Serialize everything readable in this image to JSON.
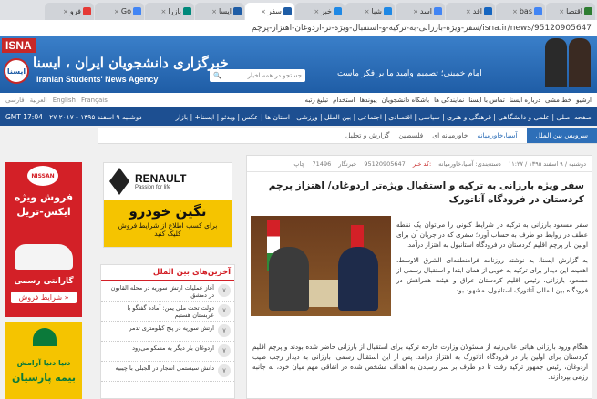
{
  "browser": {
    "tabs": [
      {
        "label": "اقتصا",
        "color": "#2e7d32",
        "active": false
      },
      {
        "label": "bas",
        "color": "#4285f4",
        "active": false
      },
      {
        "label": "اقد",
        "color": "#1565c0",
        "active": false
      },
      {
        "label": "اسد",
        "color": "#4285f4",
        "active": false
      },
      {
        "label": "شبا",
        "color": "#1e88e5",
        "active": false
      },
      {
        "label": "خبر",
        "color": "#1e88e5",
        "active": false
      },
      {
        "label": "سفر",
        "color": "#1f5da6",
        "active": true
      },
      {
        "label": "ایسا",
        "color": "#1f5da6",
        "active": false
      },
      {
        "label": "بازرا",
        "color": "#00897b",
        "active": false
      },
      {
        "label": "Go",
        "color": "#4285f4",
        "active": false
      },
      {
        "label": "فرو",
        "color": "#e53935",
        "active": false
      }
    ],
    "url": "isna.ir/news/95120905647/سفر-ویژه-بارزانی-به-ترکیه-و-استقبال-ویژه-تر-اردوغان-اهتزاز-پرچم"
  },
  "header": {
    "logo": "ISNA",
    "emblem": "ایسنا",
    "site_name": "خبرگزاری دانشجویان ایران ، ایسنا",
    "site_name_en": "Iranian Students' News Agency",
    "search_placeholder": "جستجو در همه اخبار",
    "slogan": "امام خمینی؛ تصمیم وامید ما بر فکر ماست"
  },
  "nav_top": {
    "links": [
      "آرشیو",
      "خط مشی",
      "درباره ایسنا",
      "تماس با ایسنا",
      "نمایندگی ها",
      "باشگاه دانشجویان",
      "پیوندها",
      "استخدام",
      "تبلیغ رتبه"
    ],
    "langs": [
      "فارسی",
      "العربية",
      "English",
      "Français"
    ]
  },
  "nav_main": {
    "date": "GMT 17:04 | دوشنبه ۹ اسفند ۱۳۹۵ - ۲۰۱۷ ۲۷",
    "links": "صفحه اصلی | علمی و دانشگاهی | فرهنگی و هنری | سیاسی | اقتصادی | اجتماعی | بین الملل | ورزشی | استان ها | عکس | ویدئو | ایسنا+ | بازار"
  },
  "breadcrumb": {
    "active": "سرویس بین الملل",
    "items": [
      "آسیا،خاورمیانه",
      "خاورمیانه ای",
      "فلسطین",
      "گزارش و تحلیل"
    ]
  },
  "ad_left": {
    "brand": "NISSAN",
    "line1": "فروش ویژه",
    "line2": "ایکس-تریل",
    "line3": "گارانتی رسمی",
    "cta": "شرایط فروش »"
  },
  "ad_left2": {
    "line1": "دنیا دنیا آرامش",
    "line2": "بیمه پارسیان"
  },
  "ad_renault": {
    "brand": "RENAULT",
    "tagline": "Passion for life",
    "line1": "نگین خودرو",
    "line2": "برای کسب اطلاع از شرایط فروش",
    "line3": "کلیک کنید"
  },
  "latest": {
    "title": "آخرین‌های بین الملل",
    "items": [
      {
        "num": "۷",
        "text": "آغاز عملیات ارتش سوریه در محله القابون در دمشق"
      },
      {
        "num": "۷",
        "text": "دولت تحت ملی یمن: آماده گفتگو با عربستان هستیم"
      },
      {
        "num": "۷",
        "text": "ارتش سوریه در پنج کیلومتری تدمر"
      },
      {
        "num": "۷",
        "text": "اردوغان بار دیگر به مسکو می‌رود"
      },
      {
        "num": "۷",
        "text": "دانش سیستمی انفجار در الجبلی با چیبیه"
      }
    ]
  },
  "article": {
    "meta": {
      "date": "دوشنبه / ۹ اسفند ۱۳۹۵ / ۱۱:۲۷",
      "category": "دسته‌بندی: آسیا،خاورمیانه",
      "code_label": "کد خبر:",
      "code": "95120905647",
      "views_label": "خبرنگار",
      "views": "71496",
      "print": "چاپ"
    },
    "title": "سفر ویژه بارزانی به ترکیه و استقبال ویژه‌تر اردوغان/ اهتزاز پرچم کردستان در فرودگاه آتاتورک",
    "para1": "سفر مسعود بارزانی به ترکیه در شرایط کنونی را می‌توان یک نقطه عطف در روابط دو طرف به حساب آورد؛ سفری که در جریان آن برای اولین بار پرچم اقلیم کردستان در فرودگاه استانبول به اهتزاز درآمد.",
    "para2": "به گزارش ایسنا، به نوشته روزنامه فرامنطقه‌ای الشرق الاوسط، اهمیت این دیدار برای ترکیه به خوبی از همان ابتدا و استقبال رسمی از مسعود بارزانی، رئیس اقلیم کردستان عراق و هیئت همراهش در فرودگاه بین المللی آتاتورک استانبول، مشهود بود.",
    "para3": "هنگام ورود بارزانی هیاتی عالی‌رتبه از مسئولان وزارت خارجه ترکیه برای استقبال از بارزانی حاضر شده بودند و پرچم اقلیم کردستان برای اولین بار در فرودگاه آتاتورک به اهتزاز درآمد. پس از این استقبال رسمی، بارزانی به دیدار رجب طیب اردوغان، رئیس جمهور ترکیه رفت تا دو طرف بر سر رسیدن به اهداف مشخص شده در اتفاقی مهم میان خود، به جانبه رزمی بپردازند."
  }
}
